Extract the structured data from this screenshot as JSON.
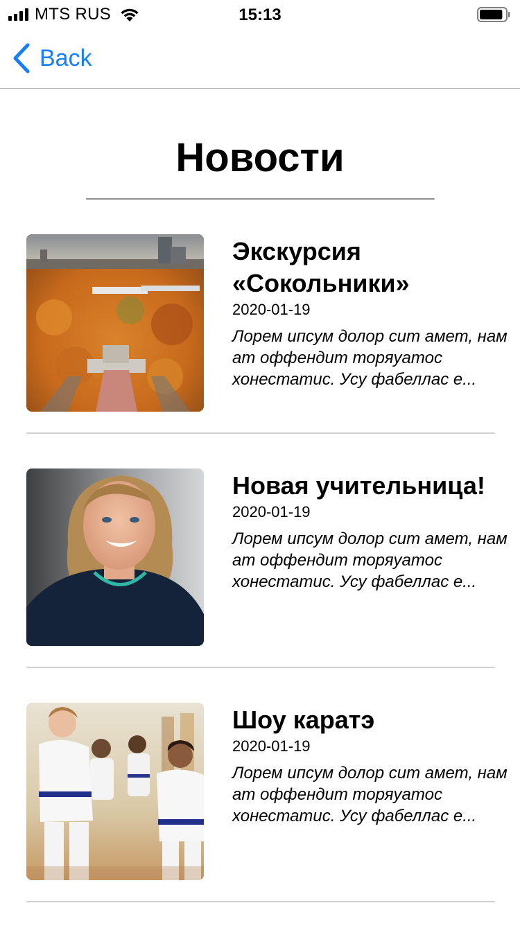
{
  "status_bar": {
    "carrier": "MTS RUS",
    "time": "15:13",
    "signal_bars": 4,
    "battery_level": 0.9
  },
  "nav": {
    "back_label": "Back",
    "back_icon": "chevron-left-icon",
    "accent_color": "#147efb"
  },
  "page": {
    "title": "Новости"
  },
  "news": [
    {
      "title": "Экскурсия «Сокольники»",
      "date": "2020-01-19",
      "excerpt": "Лорем ипсум долор сит амет, нам ат оффендит торяуатос хонестатис. Усу фабеллас е...",
      "image": "autumn-park-photo"
    },
    {
      "title": "Новая учительница!",
      "date": "2020-01-19",
      "excerpt": "Лорем ипсум долор сит амет, нам ат оффендит торяуатос хонестатис. Усу фабеллас е...",
      "image": "teacher-portrait-photo"
    },
    {
      "title": "Шоу каратэ",
      "date": "2020-01-19",
      "excerpt": "Лорем ипсум долор сит амет, нам ат оффендит торяуатос хонестатис. Усу фабеллас е...",
      "image": "karate-kids-photo"
    }
  ]
}
